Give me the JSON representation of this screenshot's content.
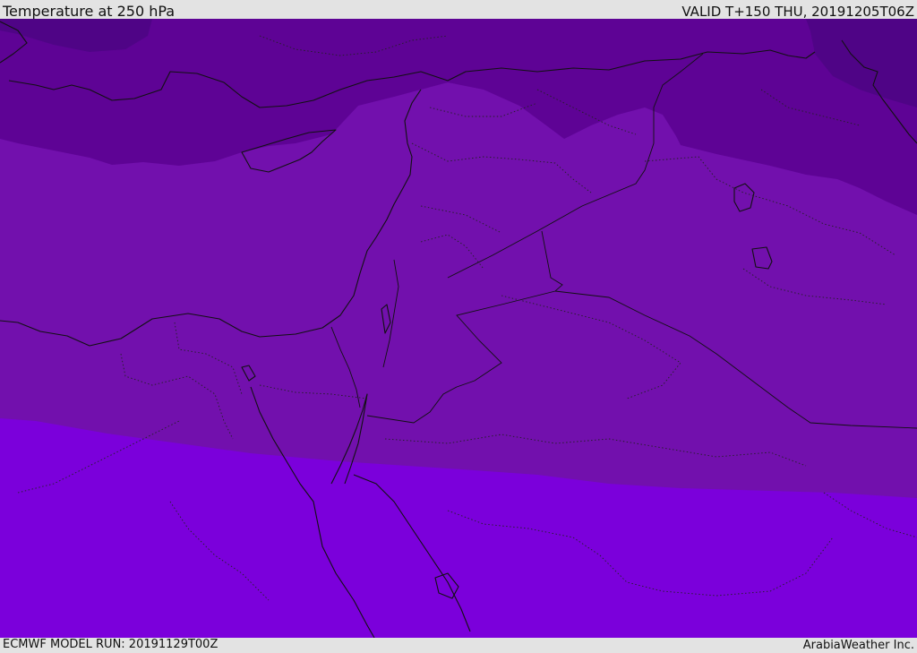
{
  "header": {
    "title": "Temperature at 250 hPa",
    "valid": "VALID T+150 THU, 20191205T06Z"
  },
  "footer": {
    "model_run": "ECMWF MODEL RUN: 20191129T00Z",
    "credit": "ArabiaWeather Inc."
  },
  "map": {
    "fill_colors": [
      "#4f0486",
      "#5e0395",
      "#7210ad",
      "#7b00db"
    ]
  }
}
